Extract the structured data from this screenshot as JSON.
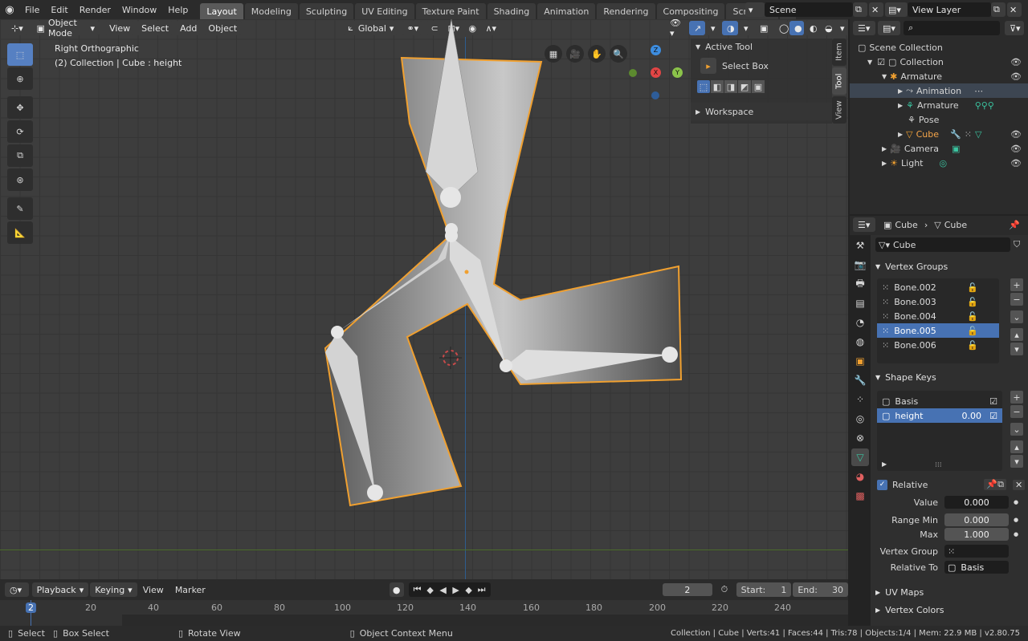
{
  "topbar": {
    "menus": [
      "File",
      "Edit",
      "Render",
      "Window",
      "Help"
    ],
    "tabs": [
      "Layout",
      "Modeling",
      "Sculpting",
      "UV Editing",
      "Texture Paint",
      "Shading",
      "Animation",
      "Rendering",
      "Compositing",
      "Scripting"
    ],
    "active_tab": "Layout",
    "add_tab": "+",
    "scene": "Scene",
    "view_layer": "View Layer"
  },
  "viewport": {
    "mode": "Object Mode",
    "menus": [
      "View",
      "Select",
      "Add",
      "Object"
    ],
    "orientation": "Global",
    "view_name": "Right Orthographic",
    "collection_info": "(2) Collection | Cube : height",
    "gizmo": {
      "z": "Z",
      "y": "Y",
      "x": "X"
    },
    "tools": [
      "select-box-icon",
      "cursor-icon",
      "move-icon",
      "rotate-icon",
      "scale-icon",
      "transform-icon",
      "annotate-icon",
      "measure-icon"
    ],
    "npanel": {
      "section1": "Active Tool",
      "tool": "Select Box",
      "section2": "Workspace",
      "tabs": [
        "Item",
        "Tool",
        "View"
      ]
    }
  },
  "timeline": {
    "menus": [
      "Playback",
      "Keying",
      "View",
      "Marker"
    ],
    "current_frame": "2",
    "start_label": "Start:",
    "start": "1",
    "end_label": "End:",
    "end": "30",
    "ruler": [
      "2",
      "20",
      "40",
      "60",
      "80",
      "100",
      "120",
      "140",
      "160",
      "180",
      "200",
      "220",
      "240"
    ]
  },
  "outliner": {
    "search_placeholder": "",
    "items": [
      {
        "label": "Scene Collection",
        "indent": 0
      },
      {
        "label": "Collection",
        "indent": 1
      },
      {
        "label": "Armature",
        "indent": 2
      },
      {
        "label": "Animation",
        "indent": 3
      },
      {
        "label": "Armature",
        "indent": 3
      },
      {
        "label": "Pose",
        "indent": 3
      },
      {
        "label": "Cube",
        "indent": 3
      },
      {
        "label": "Camera",
        "indent": 2
      },
      {
        "label": "Light",
        "indent": 2
      }
    ]
  },
  "properties": {
    "breadcrumb": {
      "object": "Cube",
      "data": "Cube"
    },
    "mesh_name": "Cube",
    "vertex_groups_title": "Vertex Groups",
    "vertex_groups": [
      "Bone.002",
      "Bone.003",
      "Bone.004",
      "Bone.005",
      "Bone.006"
    ],
    "selected_vertex_group": "Bone.005",
    "shape_keys_title": "Shape Keys",
    "shape_keys": [
      {
        "name": "Basis",
        "value": ""
      },
      {
        "name": "height",
        "value": "0.00"
      }
    ],
    "relative_label": "Relative",
    "value_label": "Value",
    "value": "0.000",
    "range_min_label": "Range Min",
    "range_min": "0.000",
    "max_label": "Max",
    "max": "1.000",
    "vertex_group_label": "Vertex Group",
    "relative_to_label": "Relative To",
    "relative_to": "Basis",
    "uv_maps_title": "UV Maps",
    "vertex_colors_title": "Vertex Colors"
  },
  "statusbar": {
    "select": "Select",
    "box_select": "Box Select",
    "rotate_view": "Rotate View",
    "context_menu": "Object Context Menu",
    "stats": "Collection | Cube | Verts:41 | Faces:44 | Tris:78 | Objects:1/4 | Mem: 22.9 MB | v2.80.75"
  },
  "colors": {
    "accent": "#4772b3",
    "selection_outline": "#f0a030",
    "x_axis": "#e24545",
    "y_axis": "#8bc34a",
    "z_axis": "#3d8de0"
  }
}
